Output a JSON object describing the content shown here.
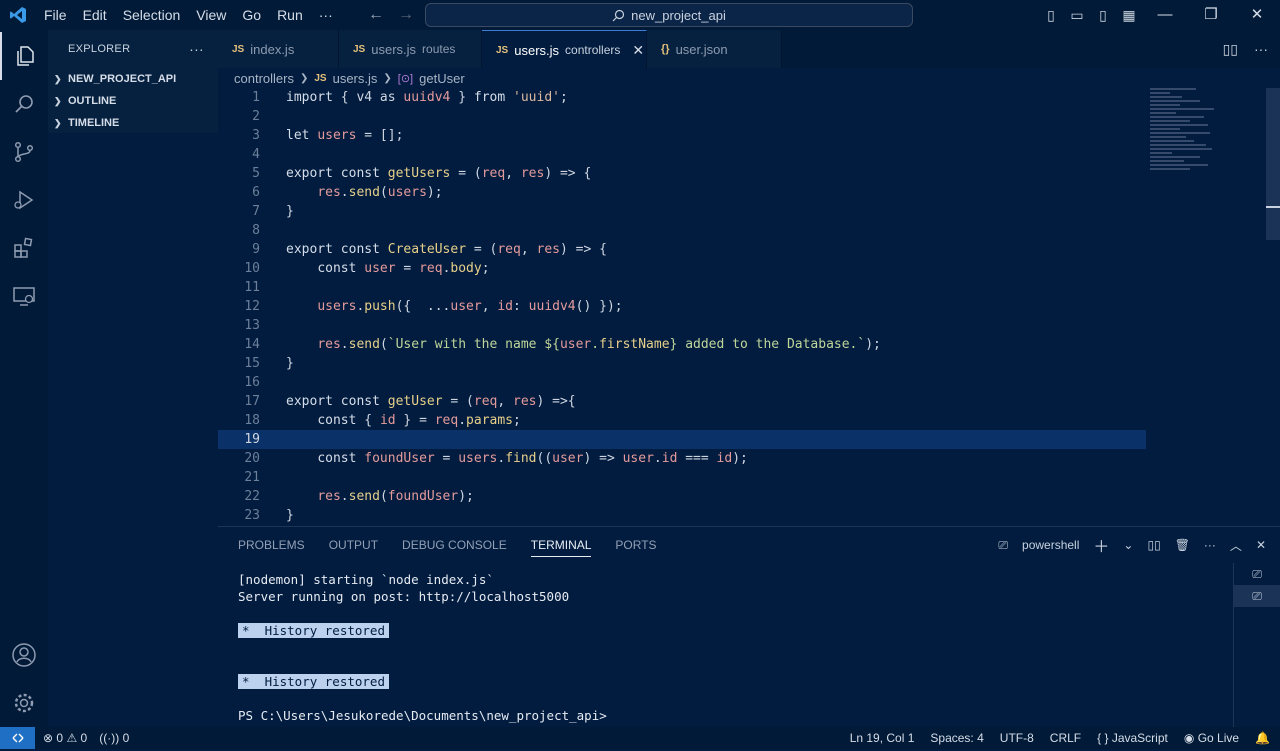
{
  "menu": [
    "File",
    "Edit",
    "Selection",
    "View",
    "Go",
    "Run",
    "···"
  ],
  "search": "new_project_api",
  "sidebar": {
    "title": "EXPLORER",
    "sections": [
      "NEW_PROJECT_API",
      "OUTLINE",
      "TIMELINE"
    ]
  },
  "tabs": [
    {
      "name": "index.js",
      "desc": ""
    },
    {
      "name": "users.js",
      "desc": "routes"
    },
    {
      "name": "users.js",
      "desc": "controllers"
    },
    {
      "name": "user.json",
      "desc": ""
    }
  ],
  "breadcrumb": [
    "controllers",
    "users.js",
    "getUser"
  ],
  "code": [
    "import { v4 as uuidv4 } from 'uuid';",
    "",
    "let users = [];",
    "",
    "export const getUsers = (req, res) => {",
    "    res.send(users);",
    "}",
    "",
    "export const CreateUser = (req, res) => {",
    "    const user = req.body;",
    "",
    "    users.push({  ...user, id: uuidv4() });",
    "",
    "    res.send(`User with the name ${user.firstName} added to the Database.`);",
    "}",
    "",
    "export const getUser = (req, res) =>{",
    "    const { id } = req.params;",
    "",
    "    const foundUser = users.find((user) => user.id === id);",
    "",
    "    res.send(foundUser);",
    "}"
  ],
  "panel": {
    "tabs": [
      "PROBLEMS",
      "OUTPUT",
      "DEBUG CONSOLE",
      "TERMINAL",
      "PORTS"
    ],
    "shell": "powershell"
  },
  "terminal": {
    "l1": "[nodemon] starting `node index.js`",
    "l2": "Server running on post: http://localhost5000",
    "hist": "*  History restored",
    "prompt": "PS C:\\Users\\Jesukorede\\Documents\\new_project_api>"
  },
  "status": {
    "errors": "0",
    "warnings": "0",
    "ports": "0",
    "pos": "Ln 19, Col 1",
    "spaces": "Spaces: 4",
    "enc": "UTF-8",
    "eol": "CRLF",
    "lang": "JavaScript",
    "live": "Go Live"
  }
}
